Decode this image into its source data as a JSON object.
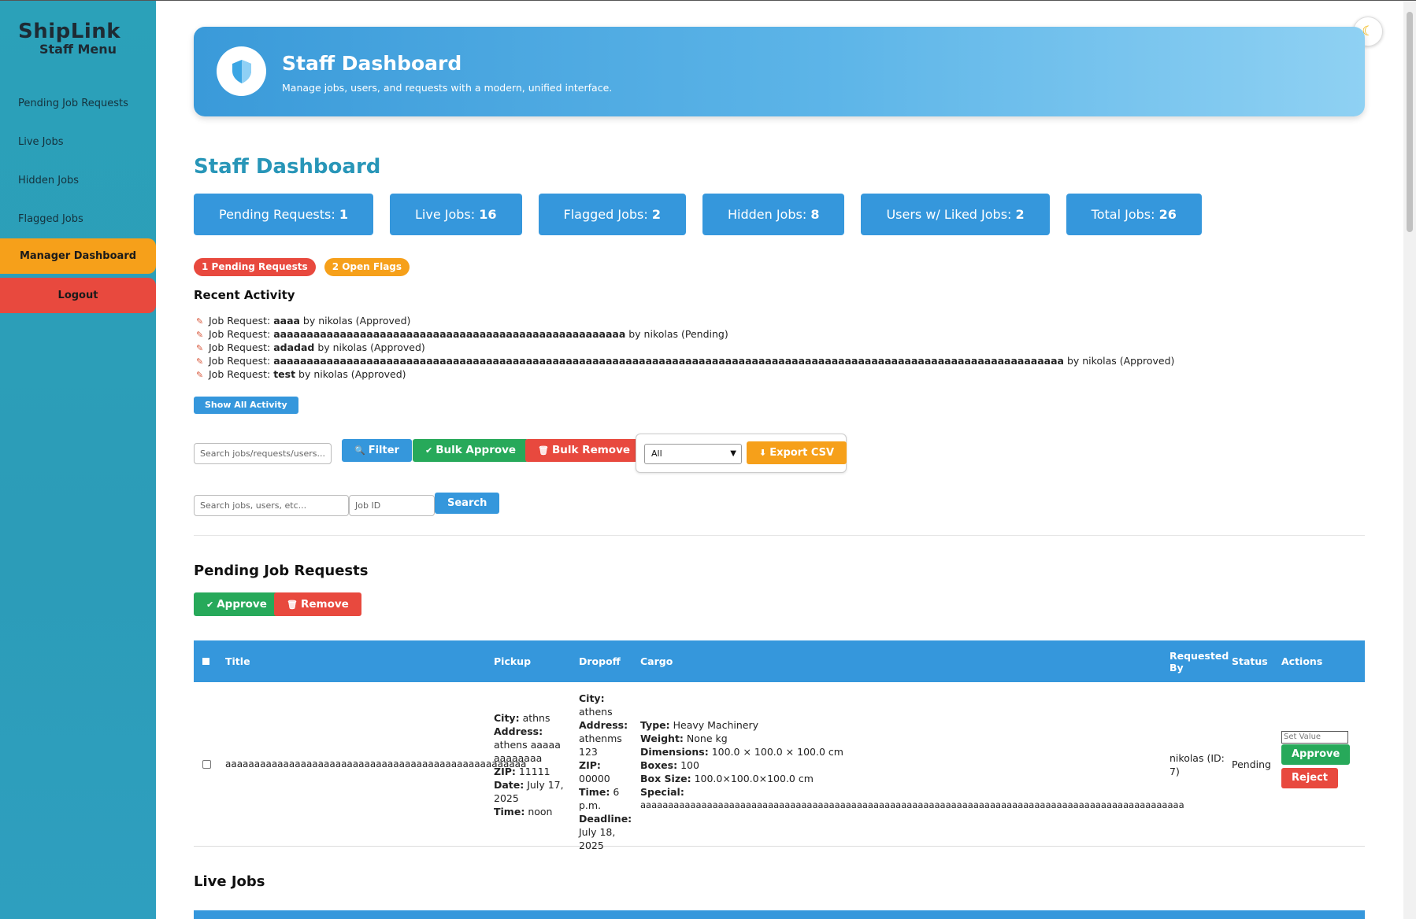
{
  "sidebar": {
    "brand_title": "ShipLink",
    "brand_subtitle": "Staff Menu",
    "items": [
      {
        "label": "Pending Job Requests"
      },
      {
        "label": "Live Jobs"
      },
      {
        "label": "Hidden Jobs"
      },
      {
        "label": "Flagged Jobs"
      }
    ],
    "manager_label": "Manager Dashboard",
    "logout_label": "Logout"
  },
  "hero": {
    "title": "Staff Dashboard",
    "subtitle": "Manage jobs, users, and requests with a modern, unified interface."
  },
  "theme_toggle_icon": "moon-icon",
  "page_title": "Staff Dashboard",
  "stats": [
    {
      "label": "Pending Requests: ",
      "value": "1"
    },
    {
      "label": "Live Jobs: ",
      "value": "16"
    },
    {
      "label": "Flagged Jobs: ",
      "value": "2"
    },
    {
      "label": "Hidden Jobs: ",
      "value": "8"
    },
    {
      "label": "Users w/ Liked Jobs: ",
      "value": "2"
    },
    {
      "label": "Total Jobs: ",
      "value": "26"
    }
  ],
  "badges": {
    "pending": "1 Pending Requests",
    "flags": "2 Open Flags"
  },
  "recent_activity": {
    "title": "Recent Activity",
    "items": [
      {
        "prefix": "Job Request: ",
        "name": "aaaa",
        "suffix": " by nikolas (Approved)"
      },
      {
        "prefix": "Job Request: ",
        "name": "aaaaaaaaaaaaaaaaaaaaaaaaaaaaaaaaaaaaaaaaaaaaaaaaaaaaa",
        "suffix": " by nikolas (Pending)"
      },
      {
        "prefix": "Job Request: ",
        "name": "adadad",
        "suffix": " by nikolas (Approved)"
      },
      {
        "prefix": "Job Request: ",
        "name": "aaaaaaaaaaaaaaaaaaaaaaaaaaaaaaaaaaaaaaaaaaaaaaaaaaaaaaaaaaaaaaaaaaaaaaaaaaaaaaaaaaaaaaaaaaaaaaaaaaaaaaaaaaaaaaaaaaaaaaa",
        "suffix": " by nikolas (Approved)"
      },
      {
        "prefix": "Job Request: ",
        "name": "test",
        "suffix": " by nikolas (Approved)"
      }
    ],
    "show_all_label": "Show All Activity"
  },
  "toolbar": {
    "search_placeholder": "Search jobs/requests/users...",
    "filter_label": "Filter",
    "bulk_approve_label": "Bulk Approve",
    "bulk_remove_label": "Bulk Remove",
    "select_value": "All",
    "export_label": "Export CSV"
  },
  "search": {
    "query_placeholder": "Search jobs, users, etc...",
    "job_id_placeholder": "Job ID",
    "button_label": "Search"
  },
  "pending_section": {
    "title": "Pending Job Requests",
    "approve_label": "Approve",
    "remove_label": "Remove",
    "columns": [
      "Title",
      "Pickup",
      "Dropoff",
      "Cargo",
      "Requested By",
      "Status",
      "Actions"
    ],
    "rows": [
      {
        "title": "aaaaaaaaaaaaaaaaaaaaaaaaaaaaaaaaaaaaaaaaaaaaaaaaaaaa",
        "pickup": {
          "city": "athns",
          "address": "athens aaaaaaaaaaaaa",
          "zip": "11111",
          "date": "July 17, 2025",
          "time": "noon"
        },
        "dropoff": {
          "city": "athens",
          "address": "athenms 123",
          "zip": "00000",
          "time": "6 p.m.",
          "deadline": "July 18, 2025"
        },
        "cargo": {
          "type": "Heavy Machinery",
          "weight": "None kg",
          "dimensions": "100.0 × 100.0 × 100.0 cm",
          "boxes": "100",
          "box_size": "100.0×100.0×100.0 cm",
          "special": "aaaaaaaaaaaaaaaaaaaaaaaaaaaaaaaaaaaaaaaaaaaaaaaaaaaaaaaaaaaaaaaaaaaaaaaaaaaaaaaaaaaaaaaaaaaaaaaaaa"
        },
        "requested_by": "nikolas (ID: 7)",
        "status": "Pending",
        "set_value_placeholder": "Set Value",
        "approve_label": "Approve",
        "reject_label": "Reject"
      }
    ]
  },
  "live_section": {
    "title": "Live Jobs"
  },
  "field_labels": {
    "city": "City:",
    "address": "Address:",
    "zip": "ZIP:",
    "date": "Date:",
    "time": "Time:",
    "deadline": "Deadline:",
    "type": "Type:",
    "weight": "Weight:",
    "dimensions": "Dimensions:",
    "boxes": "Boxes:",
    "box_size": "Box Size:",
    "special": "Special:"
  },
  "colors": {
    "sidebar": "#2ba1b9",
    "primary": "#3597dc",
    "success": "#27a95a",
    "danger": "#e8493e",
    "warning": "#f6a01a",
    "title_accent": "#2896b8"
  }
}
